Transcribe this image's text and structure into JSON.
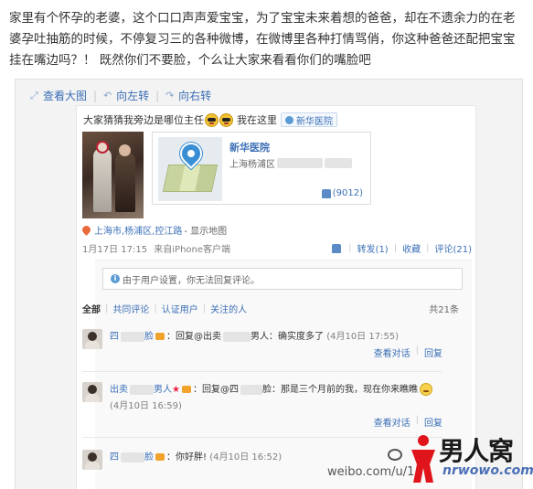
{
  "intro_text": "家里有个怀孕的老婆，这个口口声声爱宝宝，为了宝宝未来着想的爸爸，却在不遗余力的在老婆孕吐抽筋的时候，不停复习三的各种微博，在微博里各种打情骂俏，你这种爸爸还配把宝宝挂在嘴边吗？！ 既然你们不要脸，个么让大家来看看你们的嘴脸吧",
  "toolbar": {
    "view_large": "查看大图",
    "rotate_left": "向左转",
    "rotate_right": "向右转"
  },
  "post": {
    "text": "大家猜猜我旁边是哪位主任",
    "location_lead": "我在这里",
    "location_tag": "新华医院",
    "place_name": "新华医院",
    "place_address": "上海杨浦区",
    "like_count": "(9012)",
    "geo_location": "上海市,杨浦区,控江路",
    "geo_map_link": "- 显示地图",
    "date": "1月17日 17:15",
    "client": "来自iPhone客户端",
    "repost": "转发(1)",
    "favorite": "收藏",
    "comment": "评论(21)"
  },
  "comments_panel": {
    "notice": "由于用户设置，你无法回复评论。",
    "filters": [
      "全部",
      "共同评论",
      "认证用户",
      "关注的人"
    ],
    "total": "共21条",
    "items": [
      {
        "name": "四",
        "name_suffix": "脸",
        "text_a": "：回复@出卖",
        "text_b": "男人：确实度多了",
        "time": "(4月10日 17:55)",
        "view": "查看对话",
        "reply": "回复"
      },
      {
        "name": "出卖",
        "name_suffix": "男人",
        "text_a": "：回复@四",
        "text_b": "脸：那是三个月前的我，现在你来瞧瞧",
        "time": "(4月10日 16:59)",
        "view": "查看对话",
        "reply": "回复"
      },
      {
        "name": "四",
        "name_suffix": "脸",
        "text_a": "：你好胖!",
        "text_b": "",
        "time": "(4月10日 16:52)"
      }
    ]
  },
  "watermark": {
    "url": "weibo.com/u/1",
    "brand": "男人窝",
    "brand_url": "nrwowo.com"
  },
  "colors": {
    "link": "#3b6fb6",
    "brand_red": "#e0151b"
  }
}
